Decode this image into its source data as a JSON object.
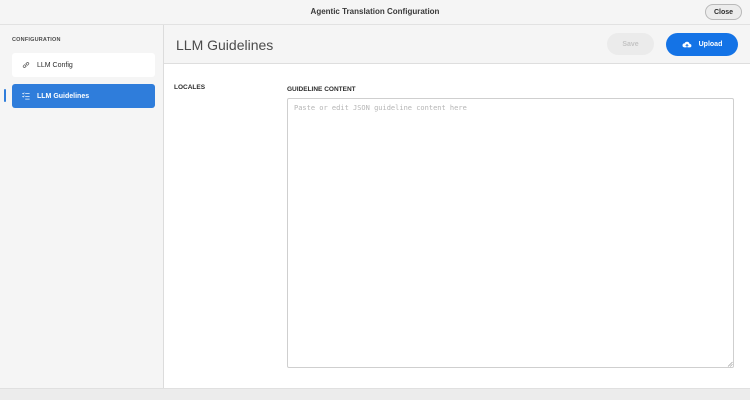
{
  "window": {
    "title": "Agentic Translation Configuration",
    "close_label": "Close"
  },
  "sidebar": {
    "heading": "CONFIGURATION",
    "items": [
      {
        "label": "LLM Config",
        "icon": "link-icon",
        "active": false
      },
      {
        "label": "LLM Guidelines",
        "icon": "list-icon",
        "active": true
      }
    ]
  },
  "main": {
    "title": "LLM Guidelines",
    "save_label": "Save",
    "upload_label": "Upload",
    "locales_label": "LOCALES",
    "guideline_label": "GUIDELINE CONTENT",
    "guideline_value": "",
    "guideline_placeholder": "Paste or edit JSON guideline content here"
  },
  "colors": {
    "accent": "#1473e6",
    "active_nav": "#2f7ddb",
    "disabled_button": "#ebebeb"
  }
}
